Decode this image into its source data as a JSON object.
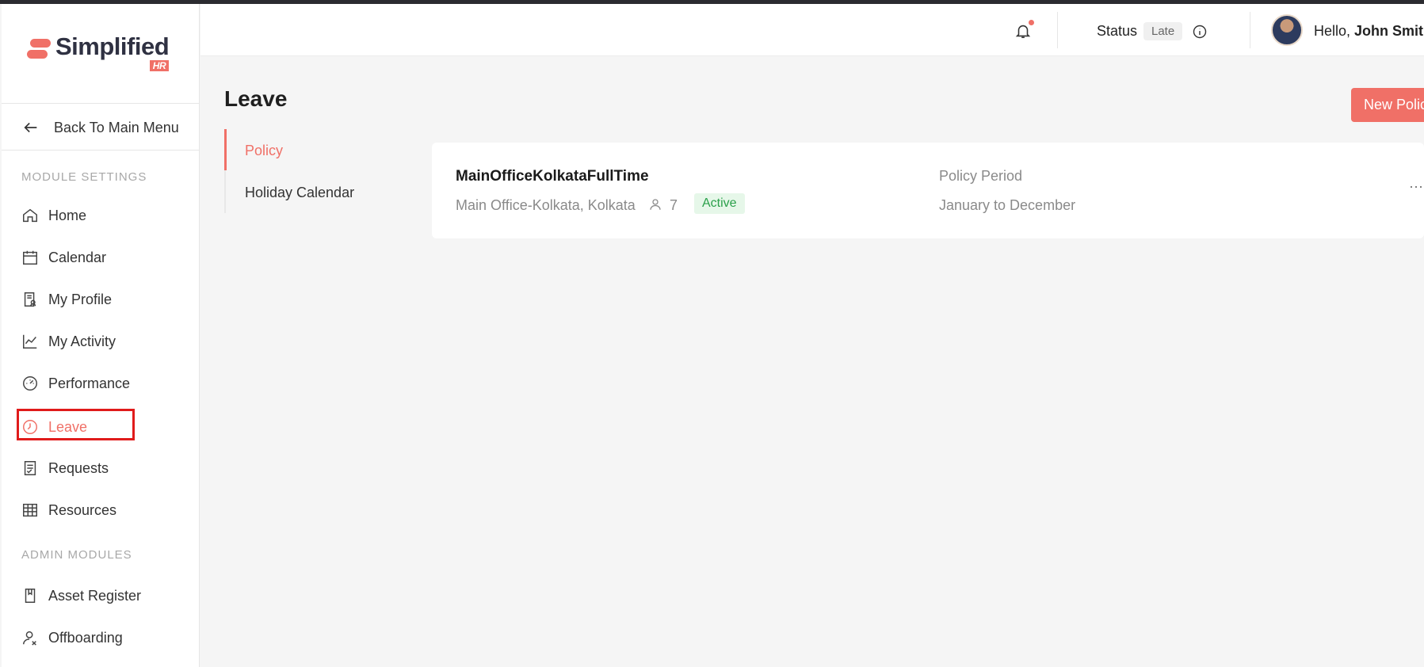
{
  "brand": {
    "name": "Simplified",
    "suffix": "HR",
    "accent": "#f07067"
  },
  "sidebar": {
    "back_label": "Back To Main Menu",
    "module_section": "MODULE SETTINGS",
    "admin_section": "ADMIN MODULES",
    "items": [
      {
        "label": "Home",
        "icon": "home-icon"
      },
      {
        "label": "Calendar",
        "icon": "calendar-icon"
      },
      {
        "label": "My Profile",
        "icon": "profile-icon"
      },
      {
        "label": "My Activity",
        "icon": "activity-icon"
      },
      {
        "label": "Performance",
        "icon": "gauge-icon"
      },
      {
        "label": "Leave",
        "icon": "clock-icon",
        "active": true
      },
      {
        "label": "Requests",
        "icon": "requests-icon"
      },
      {
        "label": "Resources",
        "icon": "table-icon"
      }
    ],
    "admin_items": [
      {
        "label": "Asset Register",
        "icon": "book-icon"
      },
      {
        "label": "Offboarding",
        "icon": "user-remove-icon"
      }
    ]
  },
  "header": {
    "status_label": "Status",
    "status_value": "Late",
    "greeting": "Hello,",
    "user_name": "John Smith"
  },
  "main": {
    "title": "Leave",
    "new_policy_label": "New Policy",
    "tabs": [
      {
        "label": "Policy",
        "active": true
      },
      {
        "label": "Holiday Calendar"
      }
    ],
    "policy": {
      "name": "MainOfficeKolkataFullTime",
      "location": "Main Office-Kolkata, Kolkata",
      "members": "7",
      "status": "Active",
      "period_label": "Policy Period",
      "period_value": "January to December"
    }
  }
}
